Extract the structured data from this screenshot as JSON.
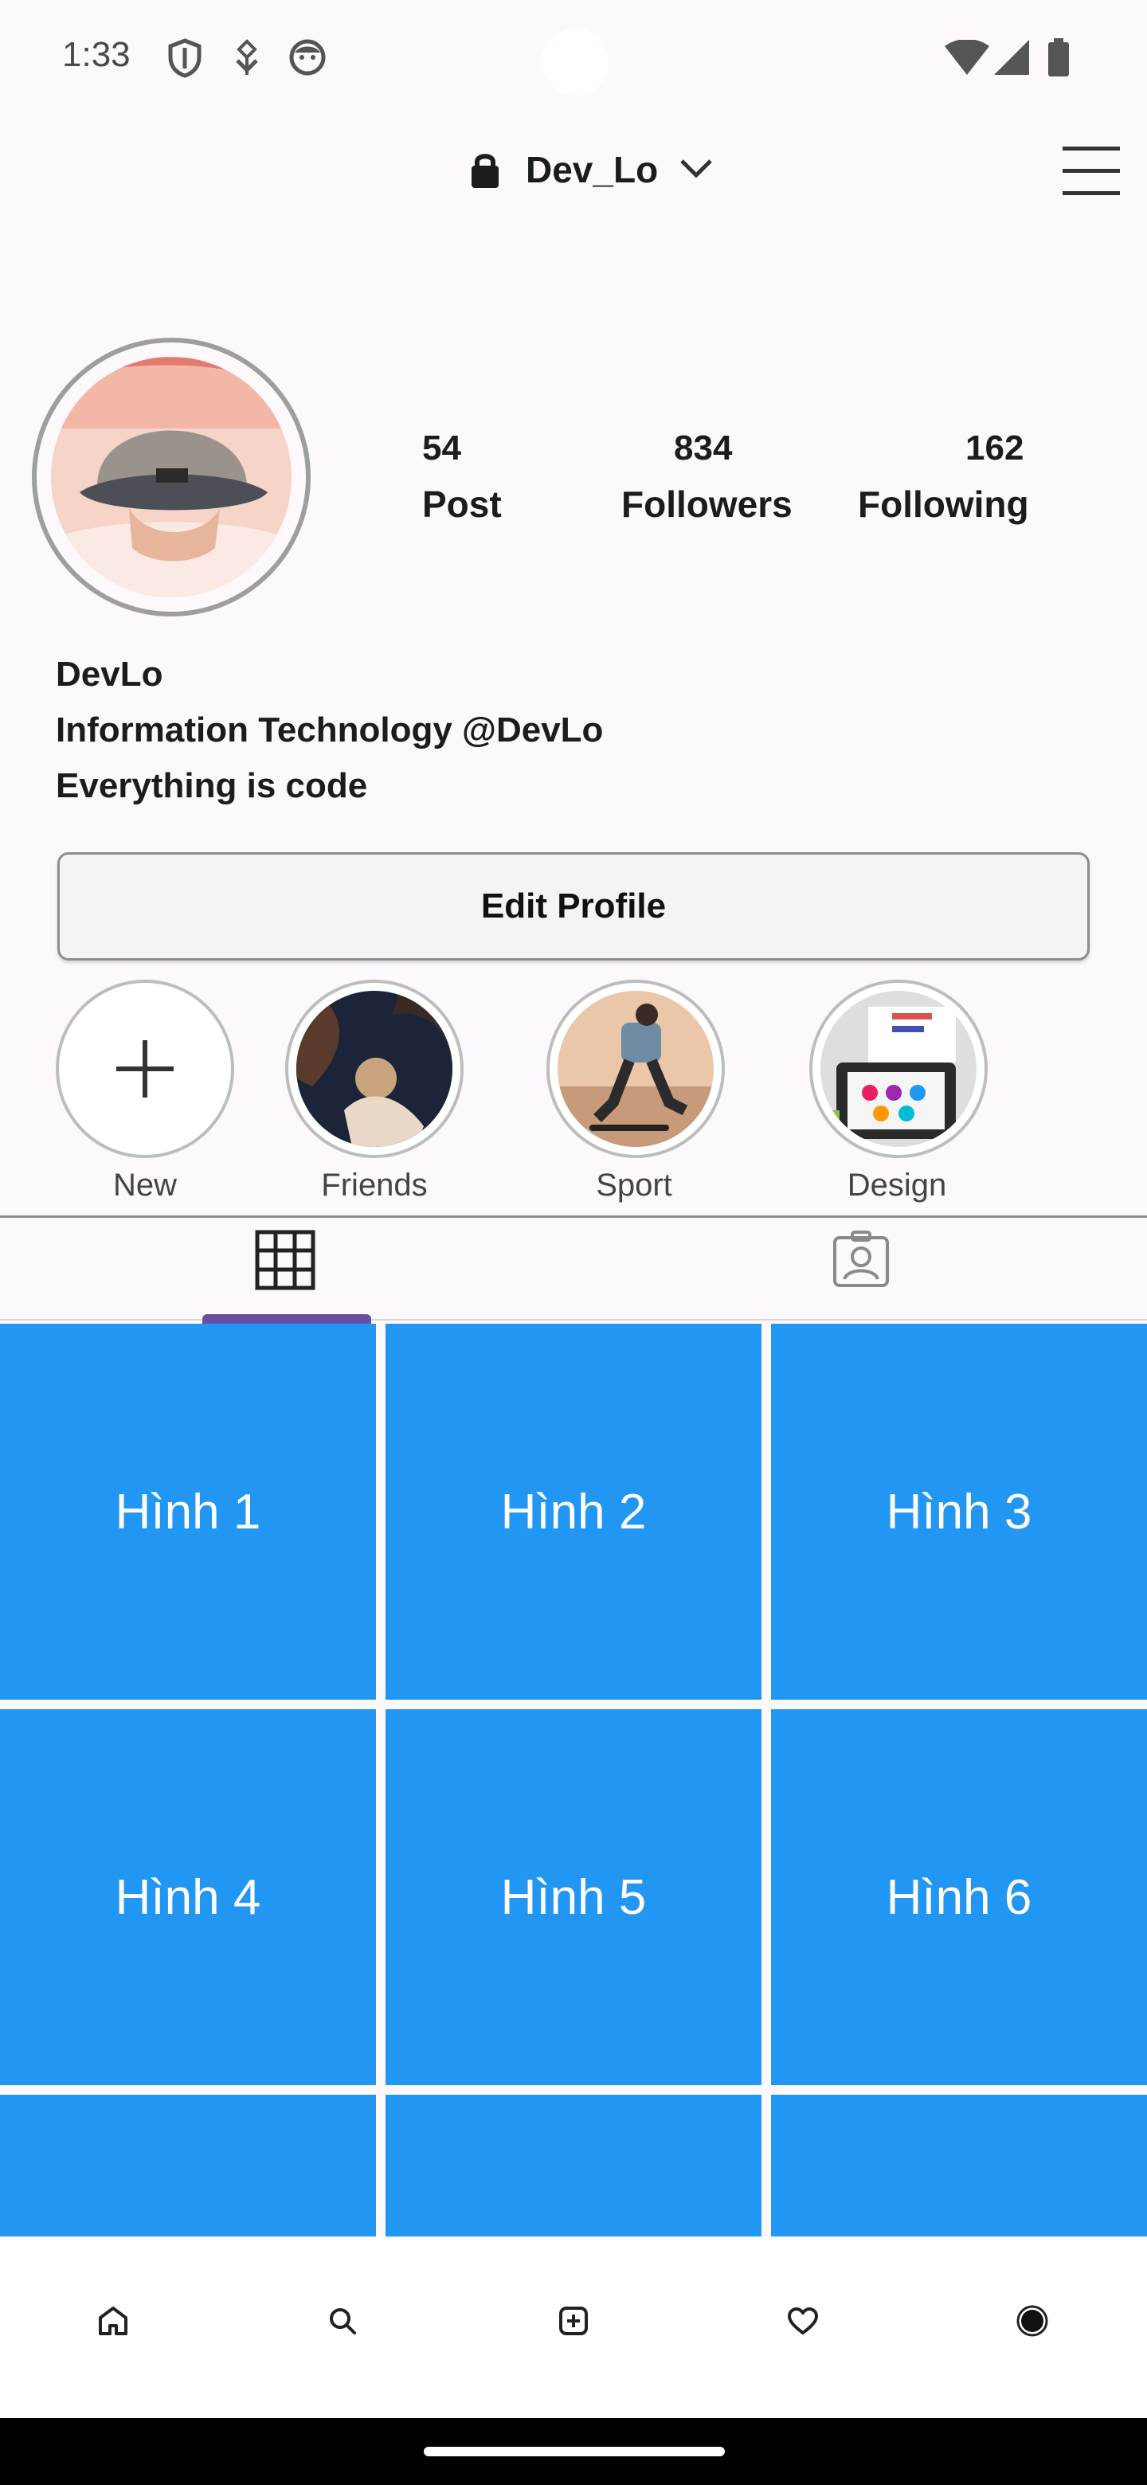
{
  "status_bar": {
    "time": "1:33",
    "icons": [
      "shield-icon",
      "usb-debug-icon",
      "notification-face-icon",
      "wifi-icon",
      "cell-signal-icon",
      "battery-icon"
    ]
  },
  "header": {
    "username": "Dev_Lo",
    "lock_icon": "lock-icon",
    "dropdown_icon": "chevron-down-icon",
    "menu_icon": "hamburger-menu-icon"
  },
  "profile": {
    "stats": [
      {
        "value": "54",
        "label": "Post"
      },
      {
        "value": "834",
        "label": "Followers"
      },
      {
        "value": "162",
        "label": "Following"
      }
    ],
    "name": "DevLo",
    "bio_line1": "Information Technology @DevLo",
    "bio_line2": "Everything is code",
    "edit_button": "Edit Profile"
  },
  "highlights": [
    {
      "label": "New"
    },
    {
      "label": "Friends"
    },
    {
      "label": "Sport"
    },
    {
      "label": "Design"
    }
  ],
  "tabs": {
    "items": [
      "grid-icon",
      "tagged-person-icon"
    ],
    "selected_index": 0
  },
  "grid": {
    "tiles": [
      "Hình 1",
      "Hình 2",
      "Hình 3",
      "Hình 4",
      "Hình 5",
      "Hình 6",
      "",
      "",
      ""
    ]
  },
  "bottom_nav": {
    "items": [
      "home-icon",
      "search-icon",
      "add-post-icon",
      "heart-icon",
      "profile-icon"
    ]
  },
  "colors": {
    "tile": "#2196f3",
    "tab_indicator": "#6750a4",
    "background": "#fdf8fb"
  }
}
